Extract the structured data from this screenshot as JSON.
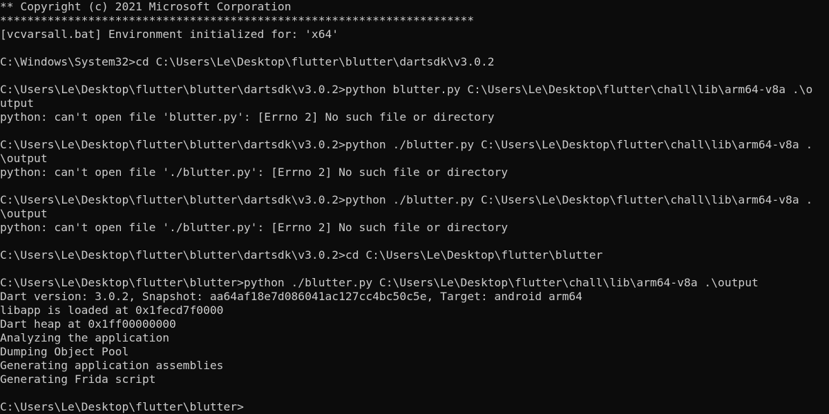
{
  "console": {
    "lines": [
      "** Copyright (c) 2021 Microsoft Corporation",
      "**********************************************************************",
      "[vcvarsall.bat] Environment initialized for: 'x64'",
      "",
      "C:\\Windows\\System32>cd C:\\Users\\Le\\Desktop\\flutter\\blutter\\dartsdk\\v3.0.2",
      "",
      "C:\\Users\\Le\\Desktop\\flutter\\blutter\\dartsdk\\v3.0.2>python blutter.py C:\\Users\\Le\\Desktop\\flutter\\chall\\lib\\arm64-v8a .\\o",
      "utput",
      "python: can't open file 'blutter.py': [Errno 2] No such file or directory",
      "",
      "C:\\Users\\Le\\Desktop\\flutter\\blutter\\dartsdk\\v3.0.2>python ./blutter.py C:\\Users\\Le\\Desktop\\flutter\\chall\\lib\\arm64-v8a .",
      "\\output",
      "python: can't open file './blutter.py': [Errno 2] No such file or directory",
      "",
      "C:\\Users\\Le\\Desktop\\flutter\\blutter\\dartsdk\\v3.0.2>python ./blutter.py C:\\Users\\Le\\Desktop\\flutter\\chall\\lib\\arm64-v8a .",
      "\\output",
      "python: can't open file './blutter.py': [Errno 2] No such file or directory",
      "",
      "C:\\Users\\Le\\Desktop\\flutter\\blutter\\dartsdk\\v3.0.2>cd C:\\Users\\Le\\Desktop\\flutter\\blutter",
      "",
      "C:\\Users\\Le\\Desktop\\flutter\\blutter>python ./blutter.py C:\\Users\\Le\\Desktop\\flutter\\chall\\lib\\arm64-v8a .\\output",
      "Dart version: 3.0.2, Snapshot: aa64af18e7d086041ac127cc4bc50c5e, Target: android arm64",
      "libapp is loaded at 0x1fecd7f0000",
      "Dart heap at 0x1ff00000000",
      "Analyzing the application",
      "Dumping Object Pool",
      "Generating application assemblies",
      "Generating Frida script",
      "",
      "C:\\Users\\Le\\Desktop\\flutter\\blutter>"
    ]
  }
}
